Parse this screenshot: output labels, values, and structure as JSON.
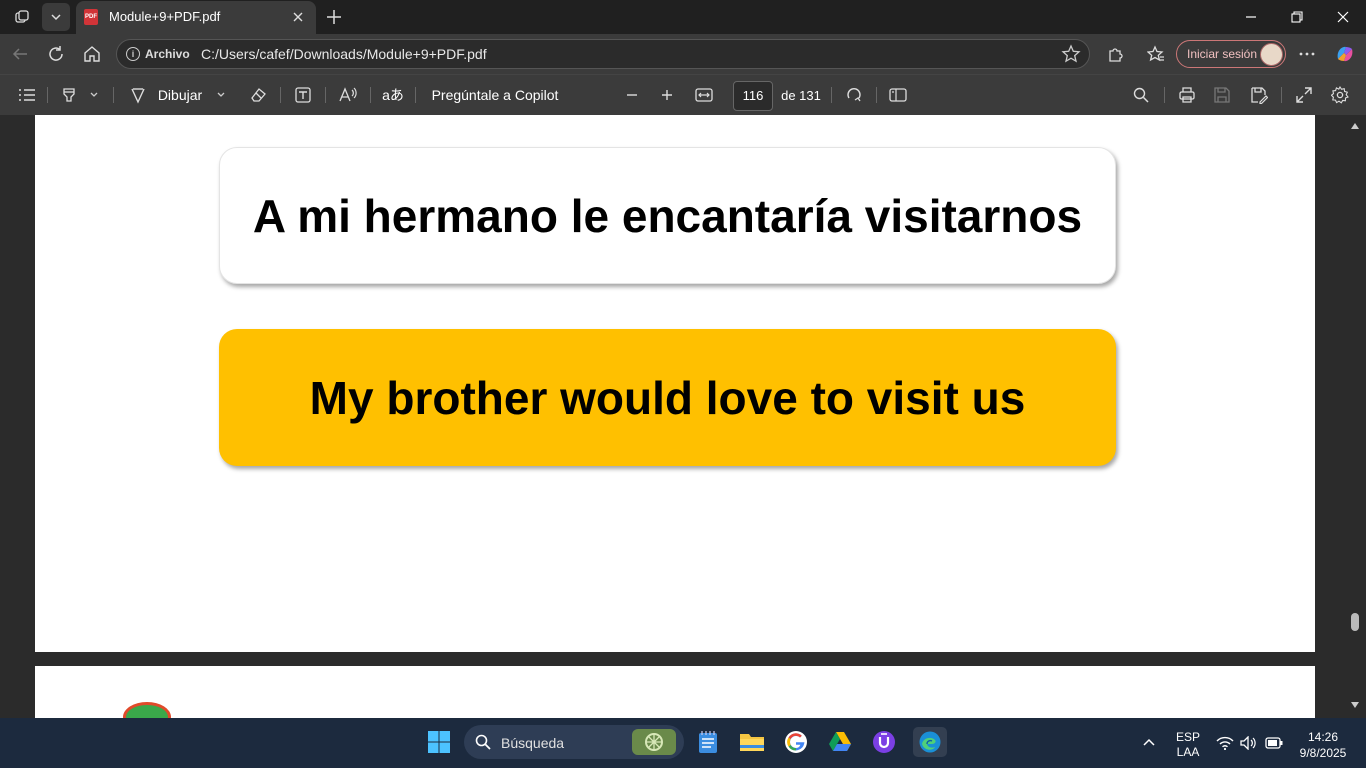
{
  "browser": {
    "tab": {
      "title": "Module+9+PDF.pdf",
      "file_badge": "PDF"
    },
    "address": {
      "site_label": "Archivo",
      "url": "C:/Users/cafef/Downloads/Module+9+PDF.pdf"
    },
    "signin_label": "Iniciar sesión"
  },
  "pdf_toolbar": {
    "draw_label": "Dibujar",
    "copilot_label": "Pregúntale a Copilot",
    "current_page": "116",
    "page_total": "de 131",
    "translate_glyph": "aあ"
  },
  "document": {
    "spanish_sentence": "A mi hermano le encantaría visitarnos",
    "english_sentence": "My brother would love to visit us"
  },
  "taskbar": {
    "search_label": "Búsqueda",
    "language": {
      "line1": "ESP",
      "line2": "LAA"
    },
    "clock": {
      "time": "14:26",
      "date": "9/8/2025"
    }
  },
  "colors": {
    "english_card": "#ffc000",
    "page_background": "#ffffff",
    "viewer_background": "#2b2b2b"
  }
}
